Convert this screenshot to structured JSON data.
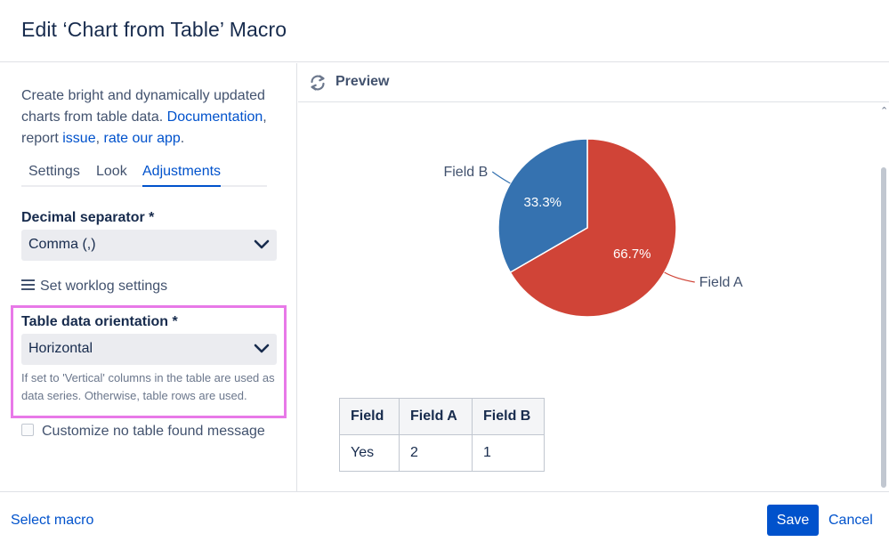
{
  "dialog": {
    "title": "Edit ‘Chart from Table’ Macro"
  },
  "sidebar": {
    "description": {
      "text1": "Create bright and dynamically updated charts from table data. ",
      "doc_link": "Documentation",
      "text2": ", report ",
      "issue_link": "issue",
      "text3": ", ",
      "rate_link": "rate our app",
      "text4": "."
    },
    "tabs": [
      {
        "label": "Settings"
      },
      {
        "label": "Look"
      },
      {
        "label": "Adjustments",
        "active": true
      }
    ],
    "decimal_separator": {
      "label": "Decimal separator *",
      "value": "Comma (,)"
    },
    "worklog_label": "Set worklog settings",
    "orientation": {
      "label": "Table data orientation *",
      "value": "Horizontal",
      "help": "If set to 'Vertical' columns in the table are used as data series. Otherwise, table rows are used."
    },
    "no_table_message": {
      "label": "Customize no table found message",
      "checked": false
    }
  },
  "preview": {
    "title": "Preview",
    "table": {
      "headers": [
        "Field",
        "Field A",
        "Field B"
      ],
      "rows": [
        [
          "Yes",
          "2",
          "1"
        ]
      ]
    }
  },
  "chart_data": {
    "type": "pie",
    "categories": [
      "Field A",
      "Field B"
    ],
    "values": [
      2,
      1
    ],
    "percent_labels": [
      "66.7%",
      "33.3%"
    ],
    "colors": [
      "#d04437",
      "#3572b0"
    ]
  },
  "footer": {
    "select_macro": "Select macro",
    "save": "Save",
    "cancel": "Cancel"
  },
  "colors": {
    "accent": "#0052cc",
    "highlight_border": "#e879e8"
  },
  "icons": {
    "refresh": "refresh-icon",
    "menu": "hamburger-icon",
    "dropdown": "chevron-down-icon"
  }
}
